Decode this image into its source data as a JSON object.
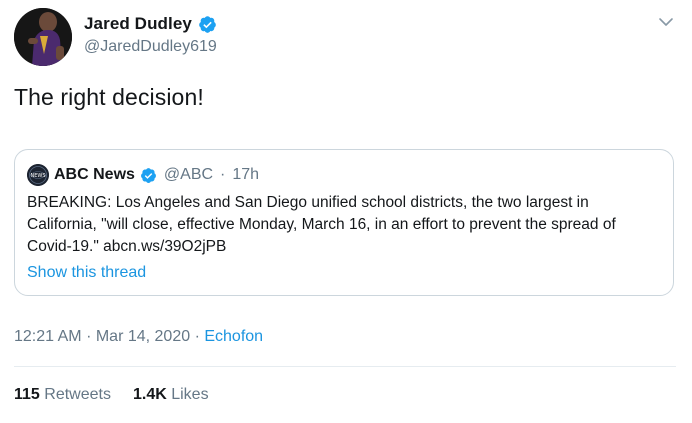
{
  "author": {
    "name": "Jared Dudley",
    "handle": "@JaredDudley619",
    "verified": true,
    "avatar_icon": "player-avatar"
  },
  "tweet": {
    "text": "The right decision!"
  },
  "quote": {
    "name": "ABC News",
    "handle": "@ABC",
    "separator": "·",
    "time": "17h",
    "avatar_text": "NEWS",
    "body": "BREAKING: Los Angeles and San Diego unified school districts, the two largest in California, \"will close, effective Monday, March 16, in an effort to prevent the spread of Covid-19.\" abcn.ws/39O2jPB",
    "show_thread": "Show this thread"
  },
  "meta": {
    "time": "12:21 AM",
    "dot1": "·",
    "date": "Mar 14, 2020",
    "dot2": "·",
    "source": "Echofon"
  },
  "stats": {
    "retweets_count": "115",
    "retweets_label": "Retweets",
    "likes_count": "1.4K",
    "likes_label": "Likes"
  },
  "colors": {
    "link": "#1b95e0",
    "verified": "#1da1f2",
    "secondary_text": "#657786",
    "border": "#ccd6dd"
  },
  "icons": {
    "verified": "verified-badge-icon",
    "more": "chevron-down-icon"
  }
}
